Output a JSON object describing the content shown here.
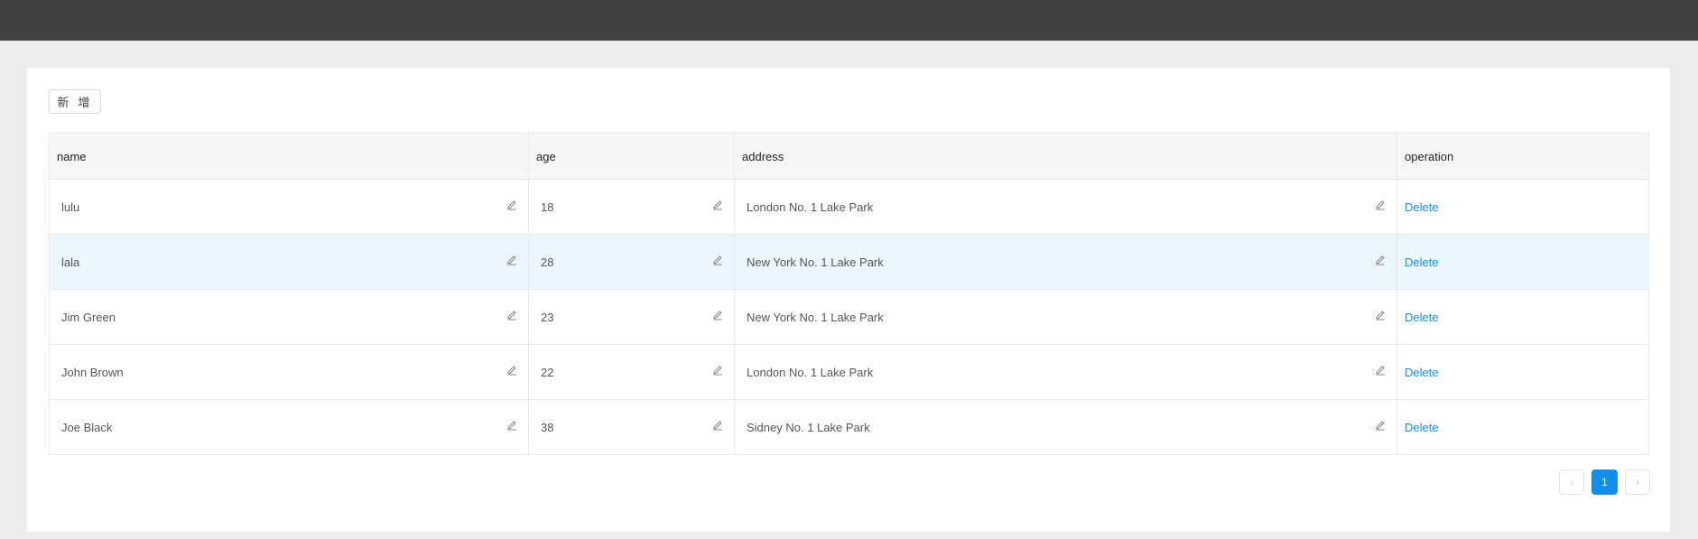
{
  "toolbar": {
    "add_label": "新 增"
  },
  "table": {
    "columns": [
      "name",
      "age",
      "address",
      "operation"
    ],
    "rows": [
      {
        "name": "lulu",
        "age": "18",
        "address": "London No. 1 Lake Park",
        "operation": "Delete"
      },
      {
        "name": "lala",
        "age": "28",
        "address": "New York No. 1 Lake Park",
        "operation": "Delete"
      },
      {
        "name": "Jim Green",
        "age": "23",
        "address": "New York No. 1 Lake Park",
        "operation": "Delete"
      },
      {
        "name": "John Brown",
        "age": "22",
        "address": "London No. 1 Lake Park",
        "operation": "Delete"
      },
      {
        "name": "Joe Black",
        "age": "38",
        "address": "Sidney No. 1 Lake Park",
        "operation": "Delete"
      }
    ],
    "highlighted_row": 1
  },
  "pagination": {
    "prev": "‹",
    "current": "1",
    "next": "›"
  },
  "colors": {
    "topbar": "#404040",
    "accent": "#108ee9",
    "row_highlight": "#ecf6fd"
  }
}
